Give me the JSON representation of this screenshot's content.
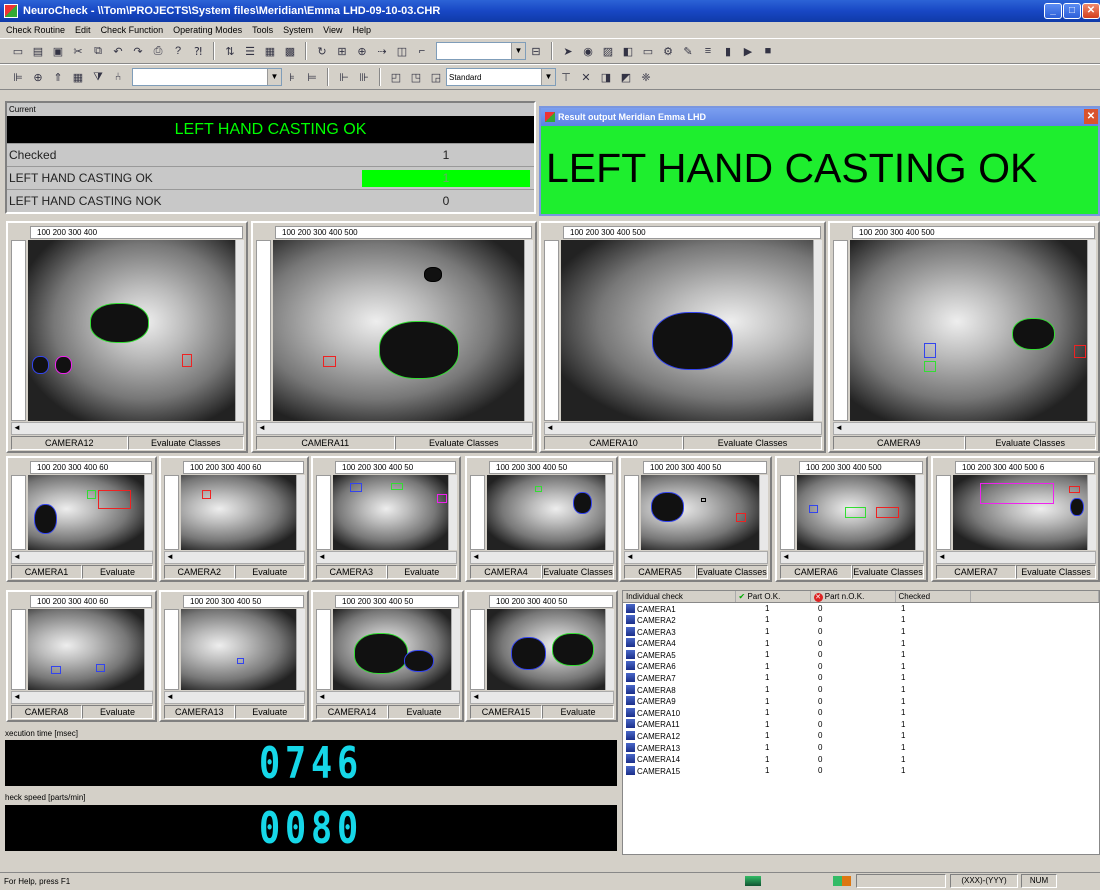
{
  "window": {
    "title": "NeuroCheck - \\\\Tom\\PROJECTS\\System files\\Meridian\\Emma LHD-09-10-03.CHR"
  },
  "menu": [
    "Check Routine",
    "Edit",
    "Check Function",
    "Operating Modes",
    "Tools",
    "System",
    "View",
    "Help"
  ],
  "toolbar": {
    "standard_select": "Standard"
  },
  "current": {
    "header": "Current",
    "banner": "LEFT HAND CASTING OK",
    "rows": [
      {
        "label": "Checked",
        "value": "1"
      },
      {
        "label": "LEFT HAND CASTING OK",
        "value": "1"
      },
      {
        "label": "LEFT HAND CASTING NOK",
        "value": "0"
      }
    ],
    "colors": {
      "ok": "#00ff00",
      "banner_text": "#00ff00"
    }
  },
  "result_output": {
    "title": "Result output Meridian Emma LHD",
    "text": "LEFT HAND CASTING OK",
    "color": "#1eee2e"
  },
  "cameras_large": [
    {
      "name": "CAMERA12",
      "mode": "Evaluate Classes",
      "ruler": "100 200 300 400"
    },
    {
      "name": "CAMERA11",
      "mode": "Evaluate Classes",
      "ruler": "100 200 300 400 500"
    },
    {
      "name": "CAMERA10",
      "mode": "Evaluate Classes",
      "ruler": "100 200 300 400 500"
    },
    {
      "name": "CAMERA9",
      "mode": "Evaluate Classes",
      "ruler": "100 200 300 400 500"
    }
  ],
  "cameras_row2": [
    {
      "name": "CAMERA1",
      "mode": "Evaluate",
      "ruler": "100 200 300 400 60"
    },
    {
      "name": "CAMERA2",
      "mode": "Evaluate",
      "ruler": "100 200 300 400 60"
    },
    {
      "name": "CAMERA3",
      "mode": "Evaluate",
      "ruler": "100 200 300 400 50"
    },
    {
      "name": "CAMERA4",
      "mode": "Evaluate Classes",
      "ruler": "100 200 300 400 50"
    },
    {
      "name": "CAMERA5",
      "mode": "Evaluate Classes",
      "ruler": "100 200 300 400 50"
    },
    {
      "name": "CAMERA6",
      "mode": "Evaluate Classes",
      "ruler": "100 200 300 400 500"
    },
    {
      "name": "CAMERA7",
      "mode": "Evaluate Classes",
      "ruler": "100 200 300 400 500 6"
    }
  ],
  "cameras_row3": [
    {
      "name": "CAMERA8",
      "mode": "Evaluate",
      "ruler": "100 200 300 400 60"
    },
    {
      "name": "CAMERA13",
      "mode": "Evaluate",
      "ruler": "100 200 300 400 50"
    },
    {
      "name": "CAMERA14",
      "mode": "Evaluate",
      "ruler": "100 200 300 400 50"
    },
    {
      "name": "CAMERA15",
      "mode": "Evaluate",
      "ruler": "100 200 300 400 50"
    }
  ],
  "execution_time": {
    "label": "xecution time [msec]",
    "value": "0746"
  },
  "check_speed": {
    "label": "heck speed [parts/min]",
    "value": "0080"
  },
  "individual_check": {
    "headers": [
      "Individual check",
      "Part O.K.",
      "Part n.O.K.",
      "Checked"
    ],
    "rows": [
      [
        "CAMERA1",
        "1",
        "0",
        "1"
      ],
      [
        "CAMERA2",
        "1",
        "0",
        "1"
      ],
      [
        "CAMERA3",
        "1",
        "0",
        "1"
      ],
      [
        "CAMERA4",
        "1",
        "0",
        "1"
      ],
      [
        "CAMERA5",
        "1",
        "0",
        "1"
      ],
      [
        "CAMERA6",
        "1",
        "0",
        "1"
      ],
      [
        "CAMERA7",
        "1",
        "0",
        "1"
      ],
      [
        "CAMERA8",
        "1",
        "0",
        "1"
      ],
      [
        "CAMERA9",
        "1",
        "0",
        "1"
      ],
      [
        "CAMERA10",
        "1",
        "0",
        "1"
      ],
      [
        "CAMERA11",
        "1",
        "0",
        "1"
      ],
      [
        "CAMERA12",
        "1",
        "0",
        "1"
      ],
      [
        "CAMERA13",
        "1",
        "0",
        "1"
      ],
      [
        "CAMERA14",
        "1",
        "0",
        "1"
      ],
      [
        "CAMERA15",
        "1",
        "0",
        "1"
      ]
    ]
  },
  "statusbar": {
    "help": "For Help, press F1",
    "coords": "(XXX)-(YYY)",
    "num": "NUM"
  }
}
